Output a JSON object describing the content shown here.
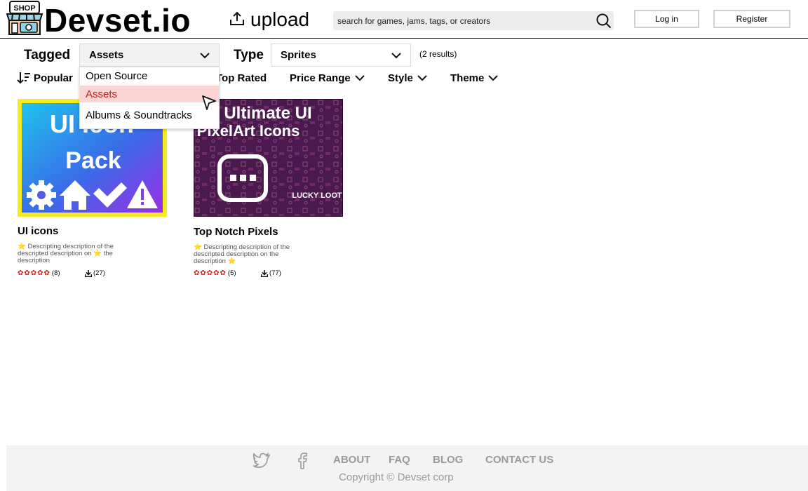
{
  "header": {
    "brand": "Devset.io",
    "logo_sign": "SHOP",
    "upload_label": "upload",
    "search_placeholder": "search for games, jams, tags, or creators",
    "login_label": "Log in",
    "register_label": "Register"
  },
  "filters": {
    "tagged_label": "Tagged",
    "tagged_value": "Assets",
    "type_label": "Type",
    "type_value": "Sprites",
    "results": "(2 results)",
    "sort_popular": "Popular",
    "sort_top_rated": "Top Rated",
    "price_range": "Price Range",
    "style": "Style",
    "theme": "Theme"
  },
  "dropdown": {
    "options": [
      "Open Source",
      "Assets",
      "Albums & Soundtracks"
    ],
    "selected": "Assets"
  },
  "cards": [
    {
      "title": "UI icons",
      "image_text_line1": "UI Icon",
      "image_text_line2": "Pack",
      "desc_part1": "Descripting description of the descripted description on",
      "desc_part2": "the description",
      "rating_count": "(8)",
      "downloads": "(27)",
      "rating_stars": 5
    },
    {
      "title": "Top Notch Pixels",
      "image_text_line1": "Ultimate UI",
      "image_text_line2": "PixelArt Icons",
      "image_badge": "LUCKY LOOT",
      "desc_part1": "Descripting description of the descripted description on the description",
      "desc_part2": "",
      "rating_count": "(5)",
      "downloads": "(77)",
      "rating_stars": 5
    }
  ],
  "footer": {
    "about": "ABOUT",
    "faq": "FAQ",
    "blog": "BLOG",
    "contact": "CONTACT US",
    "copyright": "Copyright  © Devset corp"
  },
  "colors": {
    "accent_red": "#c0171a",
    "dropdown_active_bg": "#fbd4d4",
    "star_red": "#d21d1d",
    "footer_bg": "#f3f3f3",
    "card1_border": "#f6ec1a",
    "card2_bg": "#4a1a4e"
  },
  "icons": [
    "shop-logo-icon",
    "upload-icon",
    "search-icon",
    "chevron-down-icon",
    "sort-icon",
    "cursor-icon",
    "star-icon",
    "download-icon",
    "twitter-icon",
    "facebook-icon"
  ]
}
